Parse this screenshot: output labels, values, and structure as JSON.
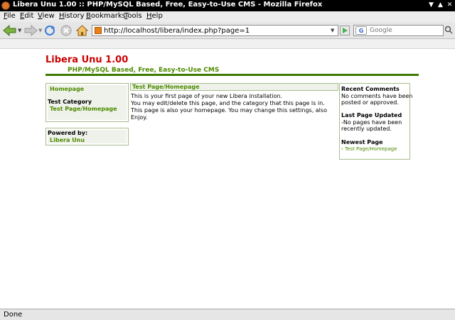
{
  "window": {
    "title": "Libera Unu 1.00 :: PHP/MySQL Based, Free, Easy-to-Use CMS - Mozilla Firefox"
  },
  "menu": [
    {
      "label": "File",
      "key": "F",
      "rest": "ile"
    },
    {
      "label": "Edit",
      "key": "E",
      "rest": "dit"
    },
    {
      "label": "View",
      "key": "V",
      "rest": "iew"
    },
    {
      "label": "History",
      "key": "H",
      "rest": "istory"
    },
    {
      "label": "Bookmarks",
      "key": "B",
      "rest": "ookmarks"
    },
    {
      "label": "Tools",
      "key": "T",
      "rest": "ools"
    },
    {
      "label": "Help",
      "key": "H",
      "rest": "elp"
    }
  ],
  "navbar": {
    "url": "http://localhost/libera/index.php?page=1",
    "search_placeholder": "Google",
    "search_engine_icon": "google-icon"
  },
  "site": {
    "title": "Libera Unu 1.00",
    "tagline": "PHP/MySQL Based, Free, Easy-to-Use CMS"
  },
  "left_nav": {
    "home_link": "Homepage",
    "category_heading": "Test Category",
    "category_link": "Test Page/Homepage"
  },
  "powered": {
    "heading": "Powered by:",
    "link": "Libera Unu"
  },
  "content": {
    "title": "Test Page/Homepage",
    "lines": [
      "This is your first page of your new Libera installation.",
      "You may edit/delete this page, and the category that this page is in.",
      "This page is also your homepage. You may change this settings, also",
      "Enjoy."
    ]
  },
  "right_panel": {
    "recent_comments_heading": "Recent Comments",
    "recent_comments_text_1": "No comments have been",
    "recent_comments_text_2": "posted or approved.",
    "last_updated_heading": "Last Page Updated",
    "last_updated_text_1": "-No pages have been",
    "last_updated_text_2": "recently updated.",
    "newest_heading": "Newest Page",
    "newest_link": "› Test Page/Homepage"
  },
  "status": {
    "text": "Done"
  },
  "colors": {
    "site_title": "#cc0000",
    "link_green": "#4e8a00",
    "rule_green": "#3c7a00",
    "box_border": "#a7bd8c",
    "box_fill": "#eef2ea"
  }
}
